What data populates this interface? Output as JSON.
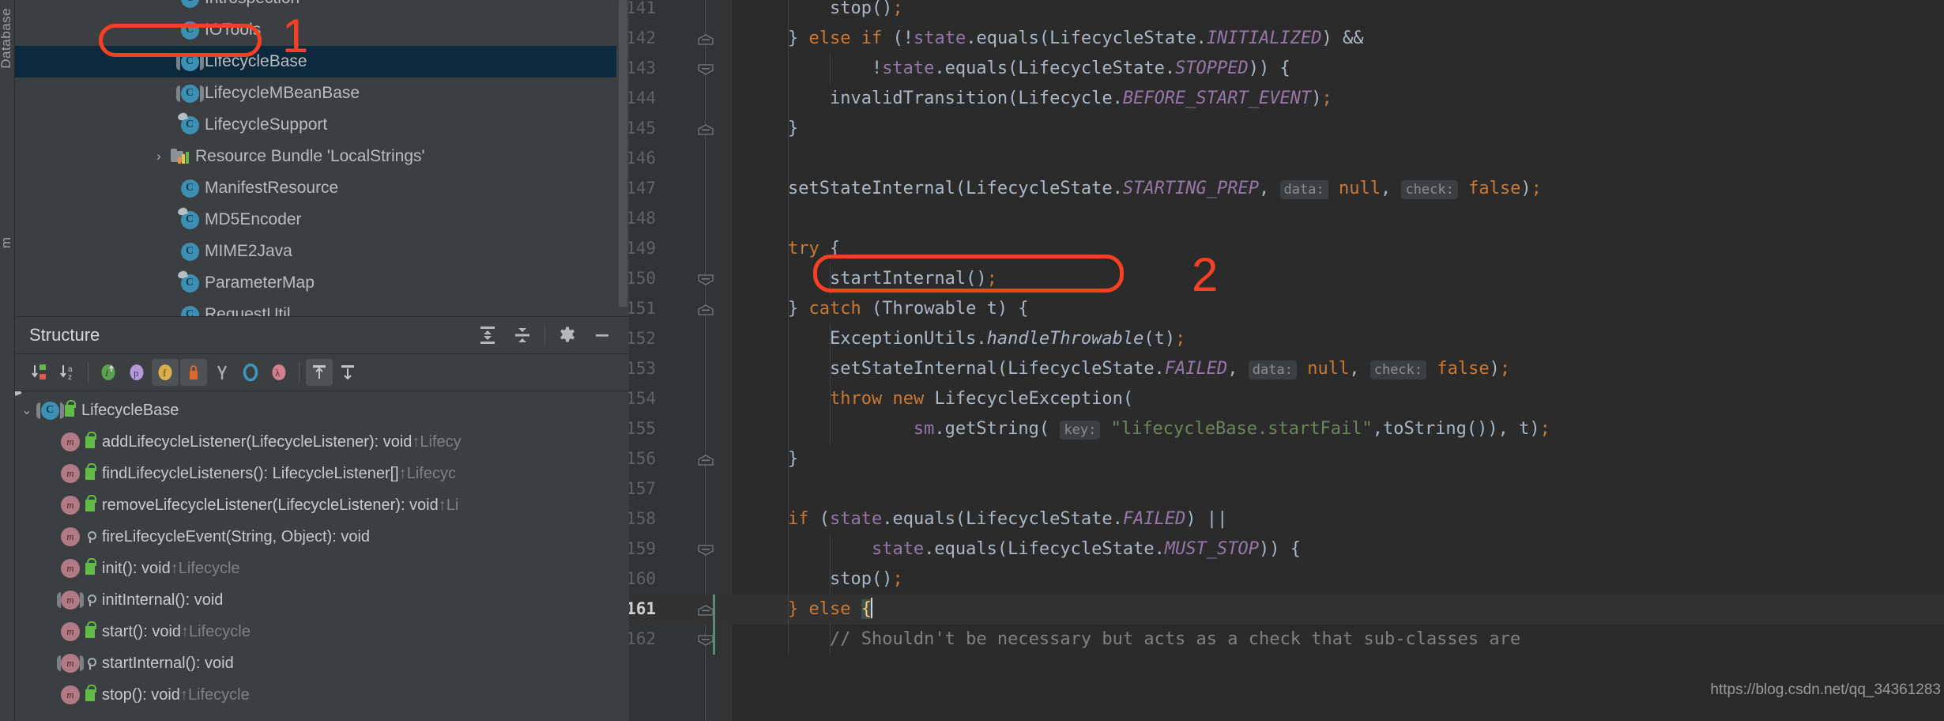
{
  "stripe": {
    "label_top": "Database",
    "label_bottom": "m"
  },
  "project_tree": {
    "items": [
      {
        "label": "Introspection",
        "icon": "class-icon",
        "indent": 1,
        "arrow": "",
        "selected": false,
        "partial": true
      },
      {
        "label": "IOTools",
        "icon": "class-icon",
        "indent": 1,
        "arrow": "",
        "selected": false
      },
      {
        "label": "LifecycleBase",
        "icon": "abstract-class-icon",
        "indent": 1,
        "arrow": "",
        "selected": true
      },
      {
        "label": "LifecycleMBeanBase",
        "icon": "abstract-class-icon",
        "indent": 1,
        "arrow": "",
        "selected": false
      },
      {
        "label": "LifecycleSupport",
        "icon": "class-override-icon",
        "indent": 1,
        "arrow": "",
        "selected": false
      },
      {
        "label": "Resource Bundle 'LocalStrings'",
        "icon": "resource-bundle-icon",
        "indent": 0,
        "arrow": "›",
        "selected": false
      },
      {
        "label": "ManifestResource",
        "icon": "class-icon",
        "indent": 1,
        "arrow": "",
        "selected": false
      },
      {
        "label": "MD5Encoder",
        "icon": "class-override-icon",
        "indent": 1,
        "arrow": "",
        "selected": false
      },
      {
        "label": "MIME2Java",
        "icon": "class-icon",
        "indent": 1,
        "arrow": "",
        "selected": false
      },
      {
        "label": "ParameterMap",
        "icon": "class-override-icon",
        "indent": 1,
        "arrow": "",
        "selected": false
      },
      {
        "label": "RequestUtil",
        "icon": "class-icon",
        "indent": 1,
        "arrow": "",
        "selected": false
      }
    ]
  },
  "structure": {
    "title": "Structure",
    "header_icons": [
      {
        "name": "expand-all-icon",
        "tooltip": "Expand All"
      },
      {
        "name": "collapse-all-icon",
        "tooltip": "Collapse All"
      },
      {
        "name": "gear-icon",
        "tooltip": "Settings"
      },
      {
        "name": "minimize-icon",
        "tooltip": "Hide"
      }
    ],
    "toolbar_icons": [
      {
        "name": "sort-by-visibility-icon",
        "active": false
      },
      {
        "name": "sort-alphabetically-icon",
        "active": false
      },
      {
        "name": "show-inherited-icon",
        "active": false
      },
      {
        "name": "show-properties-icon",
        "active": false
      },
      {
        "name": "show-fields-icon",
        "active": true
      },
      {
        "name": "show-non-public-icon",
        "active": true
      },
      {
        "name": "show-anonymous-classes-icon",
        "active": false
      },
      {
        "name": "show-interfaces-icon",
        "active": false
      },
      {
        "name": "show-lambdas-icon",
        "active": false
      },
      {
        "name": "autoscroll-to-source-icon",
        "active": true
      },
      {
        "name": "autoscroll-from-source-icon",
        "active": false
      }
    ],
    "items": [
      {
        "label": "LifecycleBase",
        "suffix": "",
        "icon": "abstract-class-icon",
        "vis": "public-lock-icon",
        "arrow": "⌄",
        "root": true
      },
      {
        "label": "addLifecycleListener(LifecycleListener): void",
        "suffix": " ↑Lifecy",
        "icon": "method-override-icon",
        "vis": "public-lock-icon",
        "arrow": ""
      },
      {
        "label": "findLifecycleListeners(): LifecycleListener[]",
        "suffix": " ↑Lifecyc",
        "icon": "method-override-icon",
        "vis": "public-lock-icon",
        "arrow": ""
      },
      {
        "label": "removeLifecycleListener(LifecycleListener): void",
        "suffix": " ↑Li",
        "icon": "method-override-icon",
        "vis": "public-lock-icon",
        "arrow": ""
      },
      {
        "label": "fireLifecycleEvent(String, Object): void",
        "suffix": "",
        "icon": "method-icon",
        "vis": "protected-key-icon",
        "arrow": ""
      },
      {
        "label": "init(): void",
        "suffix": " ↑Lifecycle",
        "icon": "method-override-icon",
        "vis": "public-lock-icon",
        "arrow": ""
      },
      {
        "label": "initInternal(): void",
        "suffix": "",
        "icon": "abstract-method-icon",
        "vis": "protected-key-icon",
        "arrow": ""
      },
      {
        "label": "start(): void",
        "suffix": " ↑Lifecycle",
        "icon": "method-override-icon",
        "vis": "public-lock-icon",
        "arrow": ""
      },
      {
        "label": "startInternal(): void",
        "suffix": "",
        "icon": "abstract-method-icon",
        "vis": "protected-key-icon",
        "arrow": ""
      },
      {
        "label": "stop(): void",
        "suffix": " ↑Lifecycle",
        "icon": "method-override-icon",
        "vis": "public-lock-icon",
        "arrow": ""
      }
    ]
  },
  "editor": {
    "first_line": 141,
    "current_line": 161,
    "line_numbers": [
      141,
      142,
      143,
      144,
      145,
      146,
      147,
      148,
      149,
      150,
      151,
      152,
      153,
      154,
      155,
      156,
      157,
      158,
      159,
      160,
      161,
      162
    ],
    "lines": [
      {
        "n": 141,
        "text": "        stop();"
      },
      {
        "n": 142,
        "text": "    } else if (!state.equals(LifecycleState.INITIALIZED) &&"
      },
      {
        "n": 143,
        "text": "            !state.equals(LifecycleState.STOPPED)) {"
      },
      {
        "n": 144,
        "text": "        invalidTransition(Lifecycle.BEFORE_START_EVENT);"
      },
      {
        "n": 145,
        "text": "    }"
      },
      {
        "n": 146,
        "text": ""
      },
      {
        "n": 147,
        "text": "    setStateInternal(LifecycleState.STARTING_PREP, data: null, check: false);"
      },
      {
        "n": 148,
        "text": ""
      },
      {
        "n": 149,
        "text": "    try {"
      },
      {
        "n": 150,
        "text": "        startInternal();"
      },
      {
        "n": 151,
        "text": "    } catch (Throwable t) {"
      },
      {
        "n": 152,
        "text": "        ExceptionUtils.handleThrowable(t);"
      },
      {
        "n": 153,
        "text": "        setStateInternal(LifecycleState.FAILED, data: null, check: false);"
      },
      {
        "n": 154,
        "text": "        throw new LifecycleException("
      },
      {
        "n": 155,
        "text": "                sm.getString( key: \"lifecycleBase.startFail\",toString()), t);"
      },
      {
        "n": 156,
        "text": "    }"
      },
      {
        "n": 157,
        "text": ""
      },
      {
        "n": 158,
        "text": "    if (state.equals(LifecycleState.FAILED) ||"
      },
      {
        "n": 159,
        "text": "            state.equals(LifecycleState.MUST_STOP)) {"
      },
      {
        "n": 160,
        "text": "        stop();"
      },
      {
        "n": 161,
        "text": "    } else {"
      },
      {
        "n": 162,
        "text": "        // Shouldn't be necessary but acts as a check that sub-classes are"
      }
    ],
    "hints": [
      {
        "line": 147,
        "labels": [
          "data:",
          "check:"
        ]
      },
      {
        "line": 153,
        "labels": [
          "data:",
          "check:"
        ]
      },
      {
        "line": 155,
        "labels": [
          "key:"
        ]
      }
    ]
  },
  "annotations": [
    {
      "number": "1",
      "target": "LifecycleBase project tree node",
      "color": "#f44123"
    },
    {
      "number": "2",
      "target": "startInternal(); call in start() method",
      "color": "#f44123"
    }
  ],
  "watermark": "https://blog.csdn.net/qq_34361283",
  "colors": {
    "panel_bg": "#3c3f41",
    "editor_bg": "#2b2b2b",
    "gutter_bg": "#313335",
    "selection_bg": "#0d293e",
    "annotation": "#f44123",
    "keyword": "#cc7832",
    "static_field": "#9876aa",
    "string": "#6a8759",
    "comment": "#808080",
    "default_text": "#a9b7c6"
  }
}
